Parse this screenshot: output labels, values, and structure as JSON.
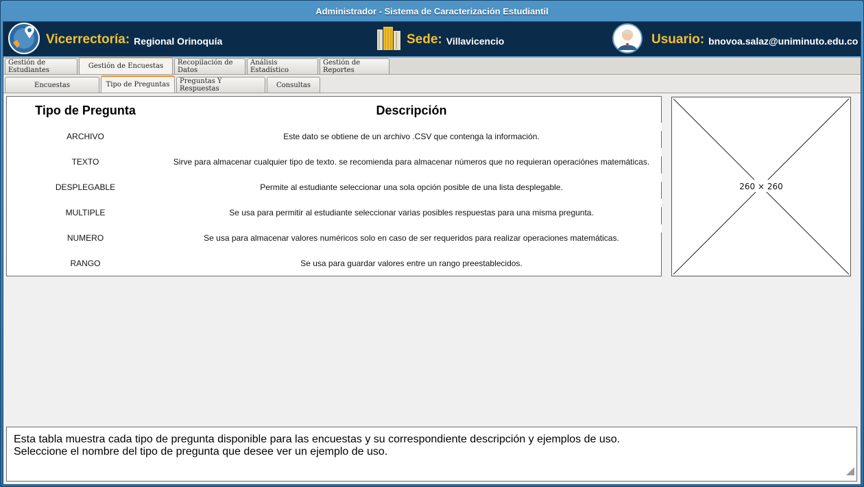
{
  "window": {
    "title": "Administrador - Sistema de Caracterización Estudiantil"
  },
  "header": {
    "vicerrectoria_label": "Vicerrectoría:",
    "vicerrectoria_value": "Regional Orinoquía",
    "sede_label": "Sede:",
    "sede_value": "Villavicencio",
    "usuario_label": "Usuario:",
    "usuario_value": "bnovoa.salaz@uniminuto.edu.co",
    "colors": {
      "label": "#f2c12e",
      "background": "#0b2b4b"
    }
  },
  "main_tabs": [
    {
      "label": "Gestión de Estudiantes",
      "active": false
    },
    {
      "label": "Gestión de Encuestas",
      "active": true
    },
    {
      "label": "Recopilación de Datos",
      "active": false
    },
    {
      "label": "Análisis Estadístico",
      "active": false
    },
    {
      "label": "Gestión de Reportes",
      "active": false
    }
  ],
  "sub_tabs": [
    {
      "label": "Encuestas",
      "active": false
    },
    {
      "label": "Tipo de Preguntas",
      "active": true
    },
    {
      "label": "Preguntas Y Respuestas",
      "active": false
    },
    {
      "label": "Consultas",
      "active": false
    }
  ],
  "table": {
    "headers": {
      "type": "Tipo de Pregunta",
      "description": "Descripción"
    },
    "rows": [
      {
        "type": "ARCHIVO",
        "description": "Este dato se obtiene de un archivo .CSV que contenga la información."
      },
      {
        "type": "TEXTO",
        "description": "Sirve para almacenar cualquier tipo de texto. se recomienda para almacenar números que no requieran operaciónes matemáticas."
      },
      {
        "type": "DESPLEGABLE",
        "description": "Permite al estudiante seleccionar una sola opción posible de una lista desplegable."
      },
      {
        "type": "MULTIPLE",
        "description": "Se usa para permitir al estudiante seleccionar varias posibles respuestas para una misma pregunta."
      },
      {
        "type": "NUMERO",
        "description": "Se usa para almacenar valores numéricos solo en caso de ser requeridos para realizar operaciones matemáticas."
      },
      {
        "type": "RANGO",
        "description": "Se usa para guardar valores entre un rango preestablecidos."
      }
    ]
  },
  "image_placeholder": {
    "label": "260 × 260"
  },
  "note": {
    "line1": "Esta tabla muestra cada tipo de pregunta disponible para las encuestas y su correspondiente descripción y ejemplos de uso.",
    "line2": "Seleccione el nombre del tipo de pregunta que desee ver un ejemplo de uso."
  },
  "icons": [
    "location-icon",
    "building-icon",
    "user-avatar-icon",
    "resize-grip-icon"
  ]
}
